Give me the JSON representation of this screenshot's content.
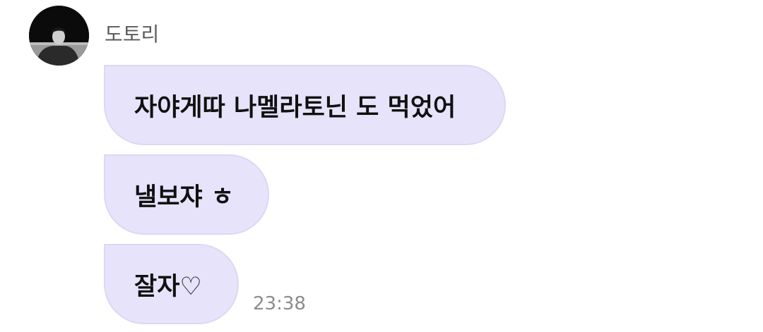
{
  "conversation": {
    "sender": {
      "name": "도토리",
      "avatar": "profile-photo"
    },
    "messages": [
      {
        "text": "자야게따 나멜라토닌 도 먹었어"
      },
      {
        "text": "낼보쟈 ㅎ"
      },
      {
        "text": "잘자♡"
      }
    ],
    "timestamp": "23:38"
  },
  "colors": {
    "bubble_background": "#e6e3fa",
    "bubble_border": "#dcd8f4",
    "sender_name": "#5a5a5a",
    "timestamp": "#8c8c8c"
  }
}
